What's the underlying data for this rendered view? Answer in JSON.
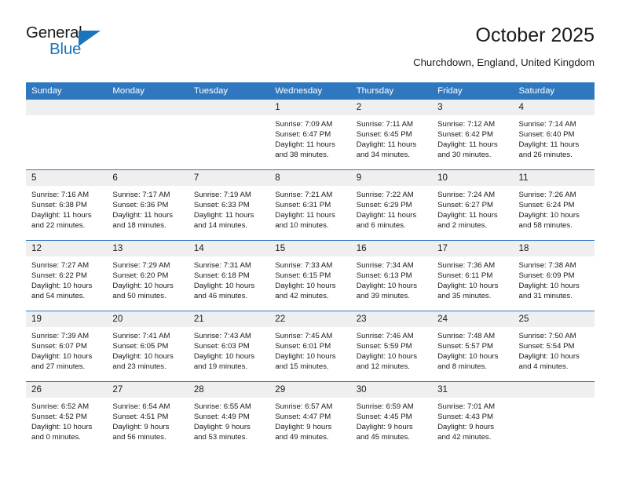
{
  "brand": {
    "name_part1": "General",
    "name_part2": "Blue",
    "accent_color": "#1c74bc"
  },
  "header": {
    "title": "October 2025",
    "subtitle": "Churchdown, England, United Kingdom"
  },
  "theme": {
    "header_row_color": "#2f78bf",
    "day_band_color": "#efeff0",
    "text_color": "#1b1b1b"
  },
  "calendar": {
    "day_names": [
      "Sunday",
      "Monday",
      "Tuesday",
      "Wednesday",
      "Thursday",
      "Friday",
      "Saturday"
    ],
    "weeks": [
      [
        {
          "day": "",
          "sunrise": "",
          "sunset": "",
          "daylight1": "",
          "daylight2": "",
          "empty": true
        },
        {
          "day": "",
          "sunrise": "",
          "sunset": "",
          "daylight1": "",
          "daylight2": "",
          "empty": true
        },
        {
          "day": "",
          "sunrise": "",
          "sunset": "",
          "daylight1": "",
          "daylight2": "",
          "empty": true
        },
        {
          "day": "1",
          "sunrise": "Sunrise: 7:09 AM",
          "sunset": "Sunset: 6:47 PM",
          "daylight1": "Daylight: 11 hours",
          "daylight2": "and 38 minutes."
        },
        {
          "day": "2",
          "sunrise": "Sunrise: 7:11 AM",
          "sunset": "Sunset: 6:45 PM",
          "daylight1": "Daylight: 11 hours",
          "daylight2": "and 34 minutes."
        },
        {
          "day": "3",
          "sunrise": "Sunrise: 7:12 AM",
          "sunset": "Sunset: 6:42 PM",
          "daylight1": "Daylight: 11 hours",
          "daylight2": "and 30 minutes."
        },
        {
          "day": "4",
          "sunrise": "Sunrise: 7:14 AM",
          "sunset": "Sunset: 6:40 PM",
          "daylight1": "Daylight: 11 hours",
          "daylight2": "and 26 minutes."
        }
      ],
      [
        {
          "day": "5",
          "sunrise": "Sunrise: 7:16 AM",
          "sunset": "Sunset: 6:38 PM",
          "daylight1": "Daylight: 11 hours",
          "daylight2": "and 22 minutes."
        },
        {
          "day": "6",
          "sunrise": "Sunrise: 7:17 AM",
          "sunset": "Sunset: 6:36 PM",
          "daylight1": "Daylight: 11 hours",
          "daylight2": "and 18 minutes."
        },
        {
          "day": "7",
          "sunrise": "Sunrise: 7:19 AM",
          "sunset": "Sunset: 6:33 PM",
          "daylight1": "Daylight: 11 hours",
          "daylight2": "and 14 minutes."
        },
        {
          "day": "8",
          "sunrise": "Sunrise: 7:21 AM",
          "sunset": "Sunset: 6:31 PM",
          "daylight1": "Daylight: 11 hours",
          "daylight2": "and 10 minutes."
        },
        {
          "day": "9",
          "sunrise": "Sunrise: 7:22 AM",
          "sunset": "Sunset: 6:29 PM",
          "daylight1": "Daylight: 11 hours",
          "daylight2": "and 6 minutes."
        },
        {
          "day": "10",
          "sunrise": "Sunrise: 7:24 AM",
          "sunset": "Sunset: 6:27 PM",
          "daylight1": "Daylight: 11 hours",
          "daylight2": "and 2 minutes."
        },
        {
          "day": "11",
          "sunrise": "Sunrise: 7:26 AM",
          "sunset": "Sunset: 6:24 PM",
          "daylight1": "Daylight: 10 hours",
          "daylight2": "and 58 minutes."
        }
      ],
      [
        {
          "day": "12",
          "sunrise": "Sunrise: 7:27 AM",
          "sunset": "Sunset: 6:22 PM",
          "daylight1": "Daylight: 10 hours",
          "daylight2": "and 54 minutes."
        },
        {
          "day": "13",
          "sunrise": "Sunrise: 7:29 AM",
          "sunset": "Sunset: 6:20 PM",
          "daylight1": "Daylight: 10 hours",
          "daylight2": "and 50 minutes."
        },
        {
          "day": "14",
          "sunrise": "Sunrise: 7:31 AM",
          "sunset": "Sunset: 6:18 PM",
          "daylight1": "Daylight: 10 hours",
          "daylight2": "and 46 minutes."
        },
        {
          "day": "15",
          "sunrise": "Sunrise: 7:33 AM",
          "sunset": "Sunset: 6:15 PM",
          "daylight1": "Daylight: 10 hours",
          "daylight2": "and 42 minutes."
        },
        {
          "day": "16",
          "sunrise": "Sunrise: 7:34 AM",
          "sunset": "Sunset: 6:13 PM",
          "daylight1": "Daylight: 10 hours",
          "daylight2": "and 39 minutes."
        },
        {
          "day": "17",
          "sunrise": "Sunrise: 7:36 AM",
          "sunset": "Sunset: 6:11 PM",
          "daylight1": "Daylight: 10 hours",
          "daylight2": "and 35 minutes."
        },
        {
          "day": "18",
          "sunrise": "Sunrise: 7:38 AM",
          "sunset": "Sunset: 6:09 PM",
          "daylight1": "Daylight: 10 hours",
          "daylight2": "and 31 minutes."
        }
      ],
      [
        {
          "day": "19",
          "sunrise": "Sunrise: 7:39 AM",
          "sunset": "Sunset: 6:07 PM",
          "daylight1": "Daylight: 10 hours",
          "daylight2": "and 27 minutes."
        },
        {
          "day": "20",
          "sunrise": "Sunrise: 7:41 AM",
          "sunset": "Sunset: 6:05 PM",
          "daylight1": "Daylight: 10 hours",
          "daylight2": "and 23 minutes."
        },
        {
          "day": "21",
          "sunrise": "Sunrise: 7:43 AM",
          "sunset": "Sunset: 6:03 PM",
          "daylight1": "Daylight: 10 hours",
          "daylight2": "and 19 minutes."
        },
        {
          "day": "22",
          "sunrise": "Sunrise: 7:45 AM",
          "sunset": "Sunset: 6:01 PM",
          "daylight1": "Daylight: 10 hours",
          "daylight2": "and 15 minutes."
        },
        {
          "day": "23",
          "sunrise": "Sunrise: 7:46 AM",
          "sunset": "Sunset: 5:59 PM",
          "daylight1": "Daylight: 10 hours",
          "daylight2": "and 12 minutes."
        },
        {
          "day": "24",
          "sunrise": "Sunrise: 7:48 AM",
          "sunset": "Sunset: 5:57 PM",
          "daylight1": "Daylight: 10 hours",
          "daylight2": "and 8 minutes."
        },
        {
          "day": "25",
          "sunrise": "Sunrise: 7:50 AM",
          "sunset": "Sunset: 5:54 PM",
          "daylight1": "Daylight: 10 hours",
          "daylight2": "and 4 minutes."
        }
      ],
      [
        {
          "day": "26",
          "sunrise": "Sunrise: 6:52 AM",
          "sunset": "Sunset: 4:52 PM",
          "daylight1": "Daylight: 10 hours",
          "daylight2": "and 0 minutes."
        },
        {
          "day": "27",
          "sunrise": "Sunrise: 6:54 AM",
          "sunset": "Sunset: 4:51 PM",
          "daylight1": "Daylight: 9 hours",
          "daylight2": "and 56 minutes."
        },
        {
          "day": "28",
          "sunrise": "Sunrise: 6:55 AM",
          "sunset": "Sunset: 4:49 PM",
          "daylight1": "Daylight: 9 hours",
          "daylight2": "and 53 minutes."
        },
        {
          "day": "29",
          "sunrise": "Sunrise: 6:57 AM",
          "sunset": "Sunset: 4:47 PM",
          "daylight1": "Daylight: 9 hours",
          "daylight2": "and 49 minutes."
        },
        {
          "day": "30",
          "sunrise": "Sunrise: 6:59 AM",
          "sunset": "Sunset: 4:45 PM",
          "daylight1": "Daylight: 9 hours",
          "daylight2": "and 45 minutes."
        },
        {
          "day": "31",
          "sunrise": "Sunrise: 7:01 AM",
          "sunset": "Sunset: 4:43 PM",
          "daylight1": "Daylight: 9 hours",
          "daylight2": "and 42 minutes."
        },
        {
          "day": "",
          "sunrise": "",
          "sunset": "",
          "daylight1": "",
          "daylight2": "",
          "empty": true
        }
      ]
    ]
  }
}
